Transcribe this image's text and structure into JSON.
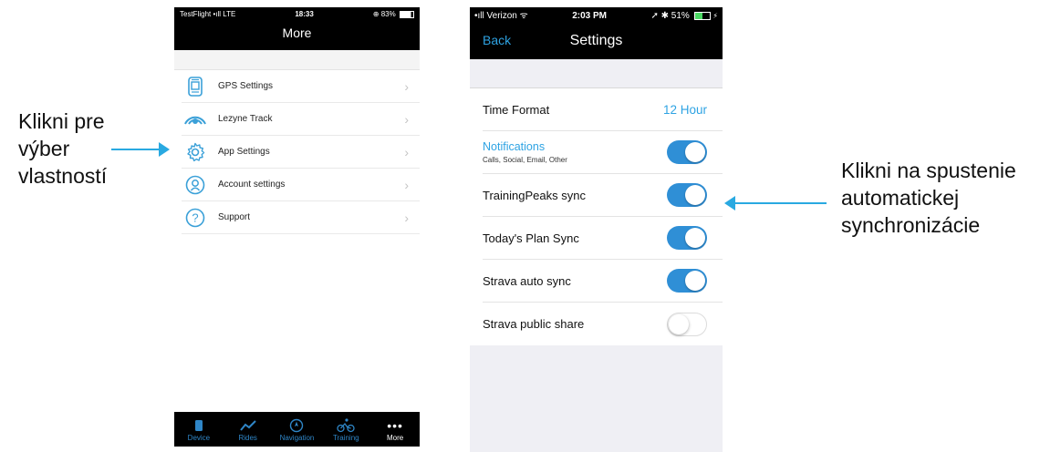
{
  "captions": {
    "left": [
      "Klikni pre",
      "výber",
      "vlastností"
    ],
    "right": [
      "Klikni na spustenie",
      "automatickej",
      "synchronizácie"
    ]
  },
  "phone1": {
    "status": {
      "left": "TestFlight",
      "carrier": "LTE",
      "time": "18:33",
      "battery": "83%"
    },
    "title": "More",
    "items": [
      {
        "label": "GPS Settings",
        "icon": "gps-device-icon"
      },
      {
        "label": "Lezyne Track",
        "icon": "track-signal-icon"
      },
      {
        "label": "App Settings",
        "icon": "gear-icon"
      },
      {
        "label": "Account settings",
        "icon": "account-icon"
      },
      {
        "label": "Support",
        "icon": "question-icon"
      }
    ],
    "tabs": [
      {
        "label": "Device",
        "icon": "phone-icon"
      },
      {
        "label": "Rides",
        "icon": "rides-chart-icon"
      },
      {
        "label": "Navigation",
        "icon": "compass-icon"
      },
      {
        "label": "Training",
        "icon": "cyclist-icon"
      },
      {
        "label": "More",
        "icon": "more-dots-icon"
      }
    ]
  },
  "phone2": {
    "status": {
      "carrier": "Verizon",
      "time": "2:03 PM",
      "battery": "51%"
    },
    "back": "Back",
    "title": "Settings",
    "time_format": {
      "label": "Time Format",
      "value": "12 Hour"
    },
    "notifications": {
      "label": "Notifications",
      "sub": "Calls, Social, Email, Other",
      "on": true
    },
    "toggles": [
      {
        "label": "TrainingPeaks sync",
        "on": true
      },
      {
        "label": "Today's Plan Sync",
        "on": true
      },
      {
        "label": "Strava auto sync",
        "on": true
      },
      {
        "label": "Strava public share",
        "on": false
      }
    ]
  },
  "colors": {
    "accent": "#2ea3e3",
    "toggle_on": "#2f8fd6",
    "arrow": "#29a9e1"
  }
}
